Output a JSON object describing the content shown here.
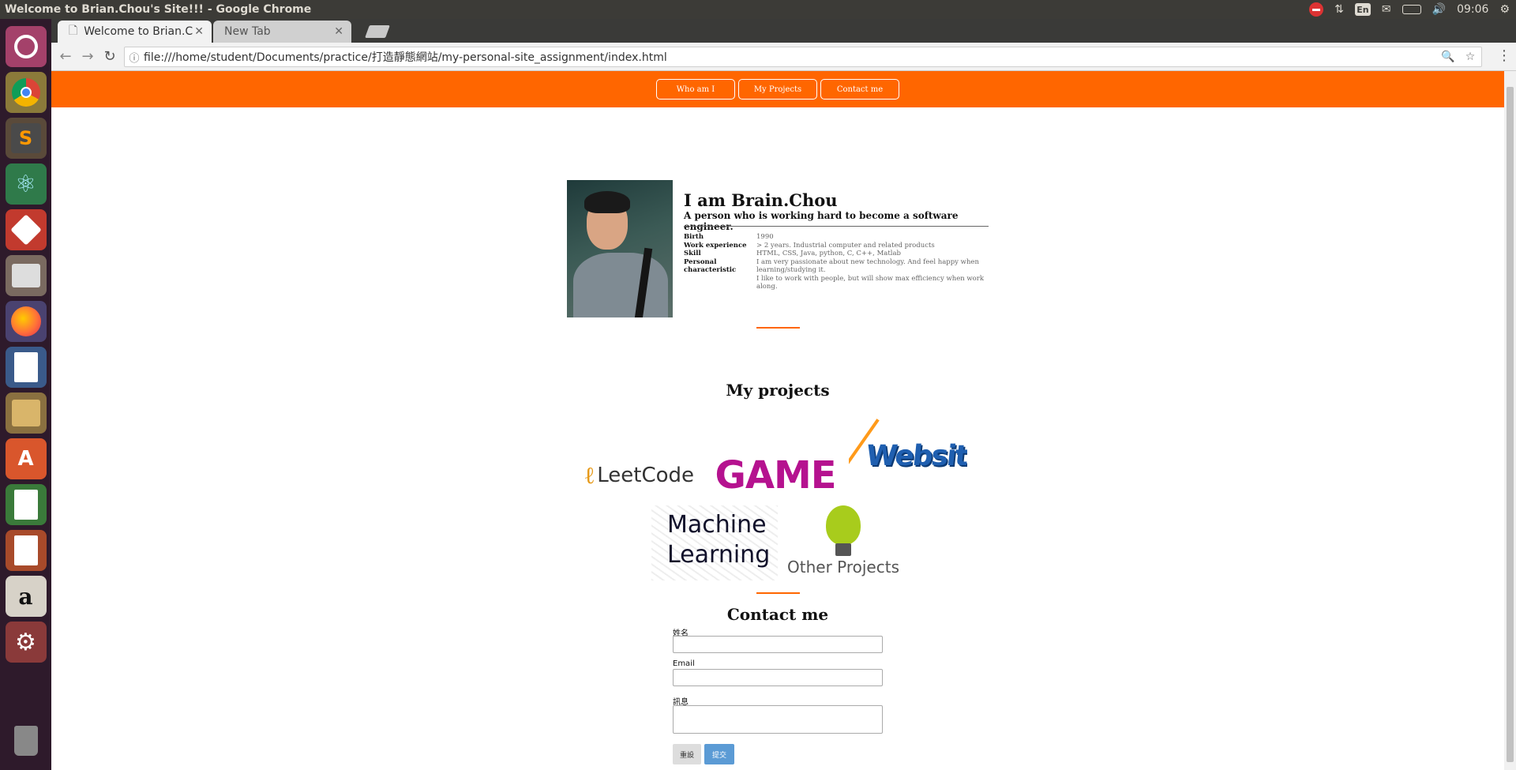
{
  "os": {
    "window_title": "Welcome to Brian.Chou's Site!!! - Google Chrome",
    "keyboard": "En",
    "clock": "09:06"
  },
  "browser": {
    "tabs": [
      {
        "label": "Welcome to Brian.C"
      },
      {
        "label": "New Tab"
      }
    ],
    "url": "file:///home/student/Documents/practice/打造靜態網站/my-personal-site_assignment/index.html"
  },
  "site": {
    "nav": [
      "Who am I",
      "My Projects",
      "Contact me"
    ],
    "profile": {
      "name": "I am Brain.Chou",
      "tagline": "A person who is working hard to become a software engineer.",
      "rows": [
        {
          "key": "Birth",
          "value": "1990"
        },
        {
          "key": "Work experience",
          "value": "> 2 years. Industrial computer and related products"
        },
        {
          "key": "Skill",
          "value": "HTML, CSS, Java, python, C, C++, Matlab"
        },
        {
          "key": "Personal characteristic",
          "value": "I am very passionate about new technology. And feel happy when learning/studying it."
        },
        {
          "key": "",
          "value": "I like to work with people, but will show max efficiency when work along."
        }
      ]
    },
    "projects_title": "My projects",
    "projects": {
      "leetcode": "LeetCode",
      "game": "GAME",
      "website": "Website",
      "ml_line1": "Machine",
      "ml_line2": "Learning",
      "other": "Other Projects"
    },
    "contact_title": "Contact me",
    "form": {
      "name_label": "姓名",
      "email_label": "Email",
      "message_label": "訊息",
      "reset": "重設",
      "submit": "提交"
    }
  },
  "colors": {
    "accent": "#ff6600",
    "submit": "#5b9bd5"
  }
}
